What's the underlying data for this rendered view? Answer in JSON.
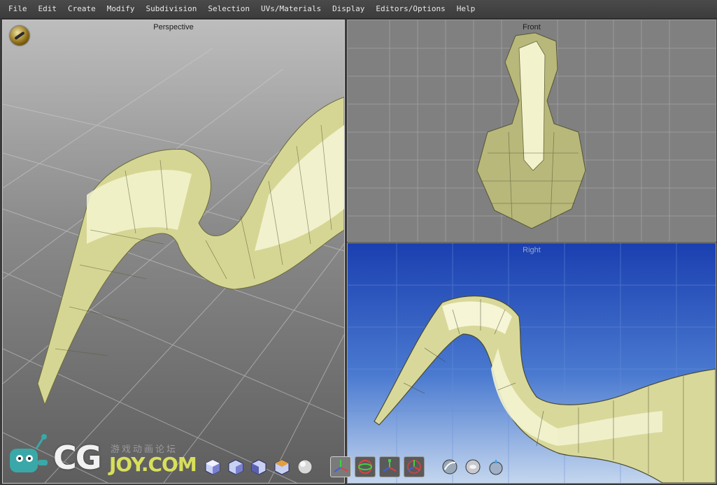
{
  "menu": {
    "items": [
      "File",
      "Edit",
      "Create",
      "Modify",
      "Subdivision",
      "Selection",
      "UVs/Materials",
      "Display",
      "Editors/Options",
      "Help"
    ]
  },
  "viewports": {
    "perspective": {
      "title": "Perspective"
    },
    "front": {
      "title": "Front"
    },
    "right": {
      "title": "Right"
    }
  },
  "watermark": {
    "brand_cg": "CG",
    "brand_joy": "JOY.COM",
    "tagline": "游戏动画论坛"
  },
  "toolbar": {
    "icons": [
      "cube-icon",
      "cube-icon",
      "cube-icon",
      "cube-icon",
      "sphere-icon",
      "axis-move-icon",
      "axis-rotate-icon",
      "axis-scale-icon",
      "axis-universal-icon",
      "material-sphere-icon",
      "lens-sphere-icon",
      "light-sphere-icon"
    ]
  },
  "colors": {
    "mesh": "#d8d89a",
    "mesh_dark": "#8e8e58",
    "right_bg_top": "#1a3fb0",
    "right_bg_bottom": "#bcd0ea"
  }
}
